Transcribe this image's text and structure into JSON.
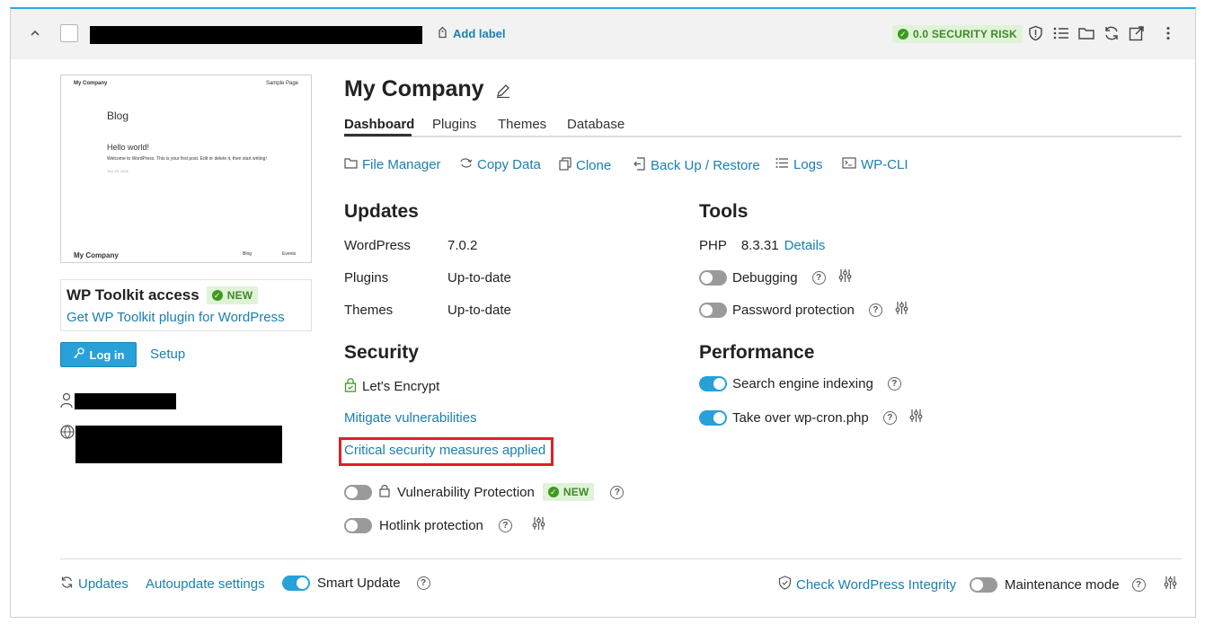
{
  "header": {
    "add_label": "Add label",
    "security_risk": "0.0 SECURITY RISK"
  },
  "preview": {
    "site_name": "My Company",
    "sample_page": "Sample Page",
    "blog_heading": "Blog",
    "post_title": "Hello world!",
    "post_excerpt": "Welcome to WordPress. This is your first post. Edit or delete it, then start writing!",
    "post_date": "July 28, 2026",
    "footer_name": "My Company",
    "footer_blog": "Blog",
    "footer_events": "Events"
  },
  "toolkit": {
    "title": "WP Toolkit access",
    "badge": "NEW",
    "link": "Get WP Toolkit plugin for WordPress"
  },
  "actions": {
    "login": "Log in",
    "setup": "Setup"
  },
  "site": {
    "title": "My Company"
  },
  "tabs": [
    "Dashboard",
    "Plugins",
    "Themes",
    "Database"
  ],
  "quick_links": [
    "File Manager",
    "Copy Data",
    "Clone",
    "Back Up / Restore",
    "Logs",
    "WP-CLI"
  ],
  "updates": {
    "heading": "Updates",
    "rows": [
      {
        "label": "WordPress",
        "value": "7.0.2"
      },
      {
        "label": "Plugins",
        "value": "Up-to-date"
      },
      {
        "label": "Themes",
        "value": "Up-to-date"
      }
    ]
  },
  "security": {
    "heading": "Security",
    "ssl": "Let's Encrypt",
    "mitigate": "Mitigate vulnerabilities",
    "critical": "Critical security measures applied",
    "vuln_protection": "Vulnerability Protection",
    "vuln_badge": "NEW",
    "hotlink": "Hotlink protection"
  },
  "tools": {
    "heading": "Tools",
    "php_label": "PHP",
    "php_version": "8.3.31",
    "php_details": "Details",
    "debugging": "Debugging",
    "password_protection": "Password protection"
  },
  "performance": {
    "heading": "Performance",
    "search_indexing": "Search engine indexing",
    "wp_cron": "Take over wp-cron.php"
  },
  "footer": {
    "updates": "Updates",
    "autoupdate": "Autoupdate settings",
    "smart_update": "Smart Update",
    "integrity": "Check WordPress Integrity",
    "maintenance": "Maintenance mode"
  },
  "colors": {
    "accent": "#28aade",
    "link": "#1a7fb0",
    "highlight": "#e01e2a",
    "badge_bg": "#e0f3d8"
  }
}
